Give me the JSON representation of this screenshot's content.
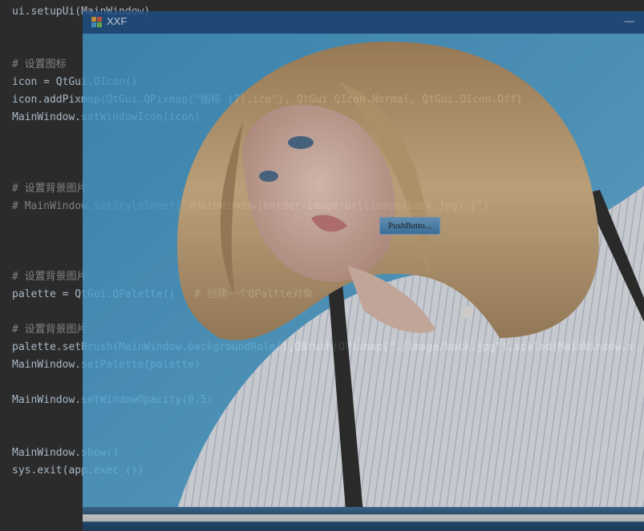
{
  "editor": {
    "lines": [
      {
        "row": 0,
        "kind": "code",
        "text": "ui.setupUi(MainWindow)"
      },
      {
        "row": 3,
        "kind": "comment",
        "text": "# 设置图标"
      },
      {
        "row": 4,
        "kind": "code",
        "text": "icon = QtGui.QIcon()"
      },
      {
        "row": 5,
        "kind": "code",
        "text": "icon.addPixmap(QtGui.QPixmap(\"图标 (7).ico\"), QtGui.QIcon.Normal, QtGui.QIcon.Off)"
      },
      {
        "row": 6,
        "kind": "code",
        "text": "MainWindow.setWindowIcon(icon)"
      },
      {
        "row": 10,
        "kind": "comment",
        "text": "# 设置背景图片"
      },
      {
        "row": 11,
        "kind": "comment",
        "text": "# MainWindow.setStyleSheet(\"#MainWindow{border-image:url(image/back.jpg);}\")"
      },
      {
        "row": 15,
        "kind": "comment",
        "text": "# 设置背景图片"
      },
      {
        "row": 16,
        "kind": "code",
        "text": "palette = QtGui.QPalette()   # 创建一个QPaltte对象"
      },
      {
        "row": 18,
        "kind": "comment",
        "text": "# 设置背景图片"
      },
      {
        "row": 19,
        "kind": "code",
        "text": "palette.setBrush(MainWindow.backgroundRole(),QBrush(QPixmap(\"./image/back.jpg\").scaled(MainWindow.s"
      },
      {
        "row": 20,
        "kind": "code",
        "text": "MainWindow.setPalette(palette)"
      },
      {
        "row": 22,
        "kind": "code",
        "text": "MainWindow.setWindowOpacity(0.5)"
      },
      {
        "row": 25,
        "kind": "code",
        "text": "MainWindow.show()"
      },
      {
        "row": 26,
        "kind": "code",
        "text": "sys.exit(app.exec_())"
      }
    ]
  },
  "app_window": {
    "title": "XXF",
    "icon": "app-window-icon",
    "minimize_label": "—",
    "push_button_label": "PushButto..."
  },
  "colors": {
    "titlebar": "#1d4f86",
    "editor_bg": "#2b2b2b",
    "comment": "#808080",
    "code": "#a9b7c6"
  }
}
